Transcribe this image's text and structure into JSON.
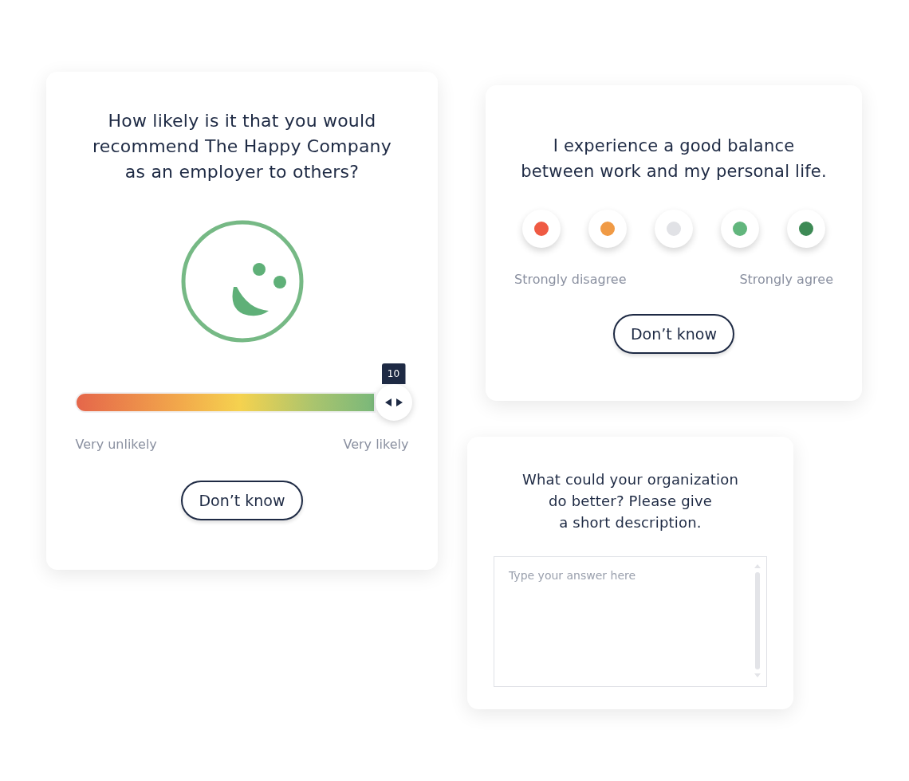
{
  "cards": [
    {
      "kind": "slider",
      "question": [
        "How likely is it that you would",
        "recommend The Happy Company",
        "as an employer to others?"
      ],
      "slider": {
        "level": 1,
        "value": "10"
      },
      "min_label": "Very unlikely",
      "max_label": "Very likely",
      "button": "Don’t know"
    },
    {
      "kind": "scale",
      "question": [
        "I experience a good balance",
        "between work and my personal life."
      ],
      "options": [
        {
          "color": "#ef5a43"
        },
        {
          "color": "#f09a45"
        },
        {
          "color": "#e1e2e6"
        },
        {
          "color": "#62b67d"
        },
        {
          "color": "#3d8a55"
        }
      ],
      "min_label": "Strongly disagree",
      "max_label": "Strongly agree",
      "button": "Don’t know"
    },
    {
      "kind": "text",
      "question": [
        "What could your organization",
        "do better? Please give",
        "a short description."
      ],
      "placeholder": "Type your answer here"
    }
  ]
}
